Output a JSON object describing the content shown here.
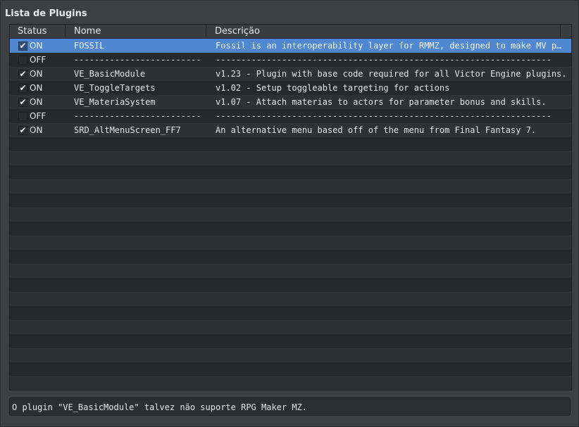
{
  "panel": {
    "title": "Lista de Plugins"
  },
  "table": {
    "columns": [
      "Status",
      "Nome",
      "Descrição"
    ],
    "rows": [
      {
        "checked": true,
        "status": "ON",
        "name": "FOSSIL",
        "description": "Fossil is an interoperability layer for RMMZ, designed to make MV p…",
        "selected": true
      },
      {
        "checked": false,
        "status": "OFF",
        "name": "-------------------------",
        "description": "------------------------------------------------------------------"
      },
      {
        "checked": true,
        "status": "ON",
        "name": "VE_BasicModule",
        "description": "v1.23 - Plugin with base code required for all Victor Engine plugins."
      },
      {
        "checked": true,
        "status": "ON",
        "name": "VE_ToggleTargets",
        "description": "v1.02 - Setup toggleable targeting for actions"
      },
      {
        "checked": true,
        "status": "ON",
        "name": "VE_MateriaSystem",
        "description": "v1.07 - Attach materias to actors for parameter bonus and skills."
      },
      {
        "checked": false,
        "status": "OFF",
        "name": "-------------------------",
        "description": "------------------------------------------------------------------"
      },
      {
        "checked": true,
        "status": "ON",
        "name": "SRD_AltMenuScreen_FF7",
        "description": "An alternative menu based off of the menu from Final Fantasy 7."
      }
    ]
  },
  "status_bar": {
    "message": "O plugin \"VE_BasicModule\" talvez não suporte RPG Maker MZ."
  },
  "icons": {
    "checkbox_checked": "checkmark-icon"
  },
  "colors": {
    "selection": "#4f87d1",
    "background": "#3d4042"
  }
}
